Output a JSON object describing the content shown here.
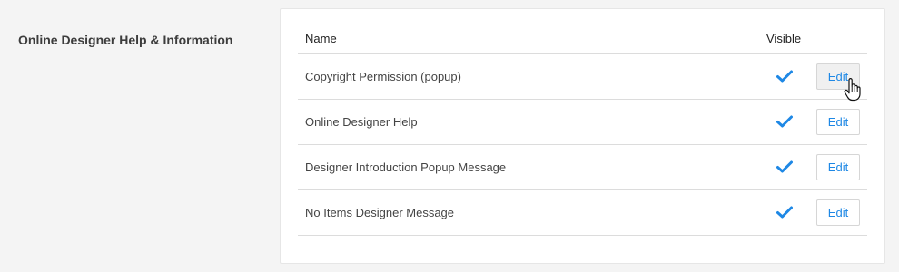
{
  "section": {
    "title": "Online Designer Help & Information"
  },
  "table": {
    "columns": {
      "name": "Name",
      "visible": "Visible"
    },
    "rows": [
      {
        "name": "Copyright Permission (popup)",
        "visible": true,
        "action_label": "Edit"
      },
      {
        "name": "Online Designer Help",
        "visible": true,
        "action_label": "Edit"
      },
      {
        "name": "Designer Introduction Popup Message",
        "visible": true,
        "action_label": "Edit"
      },
      {
        "name": "No Items Designer Message",
        "visible": true,
        "action_label": "Edit"
      }
    ]
  },
  "icons": {
    "visible": "checkmark-icon",
    "pointer": "hand-pointer-cursor-icon"
  },
  "colors": {
    "accent": "#1e88e5",
    "background": "#f4f4f4",
    "card": "#ffffff"
  }
}
